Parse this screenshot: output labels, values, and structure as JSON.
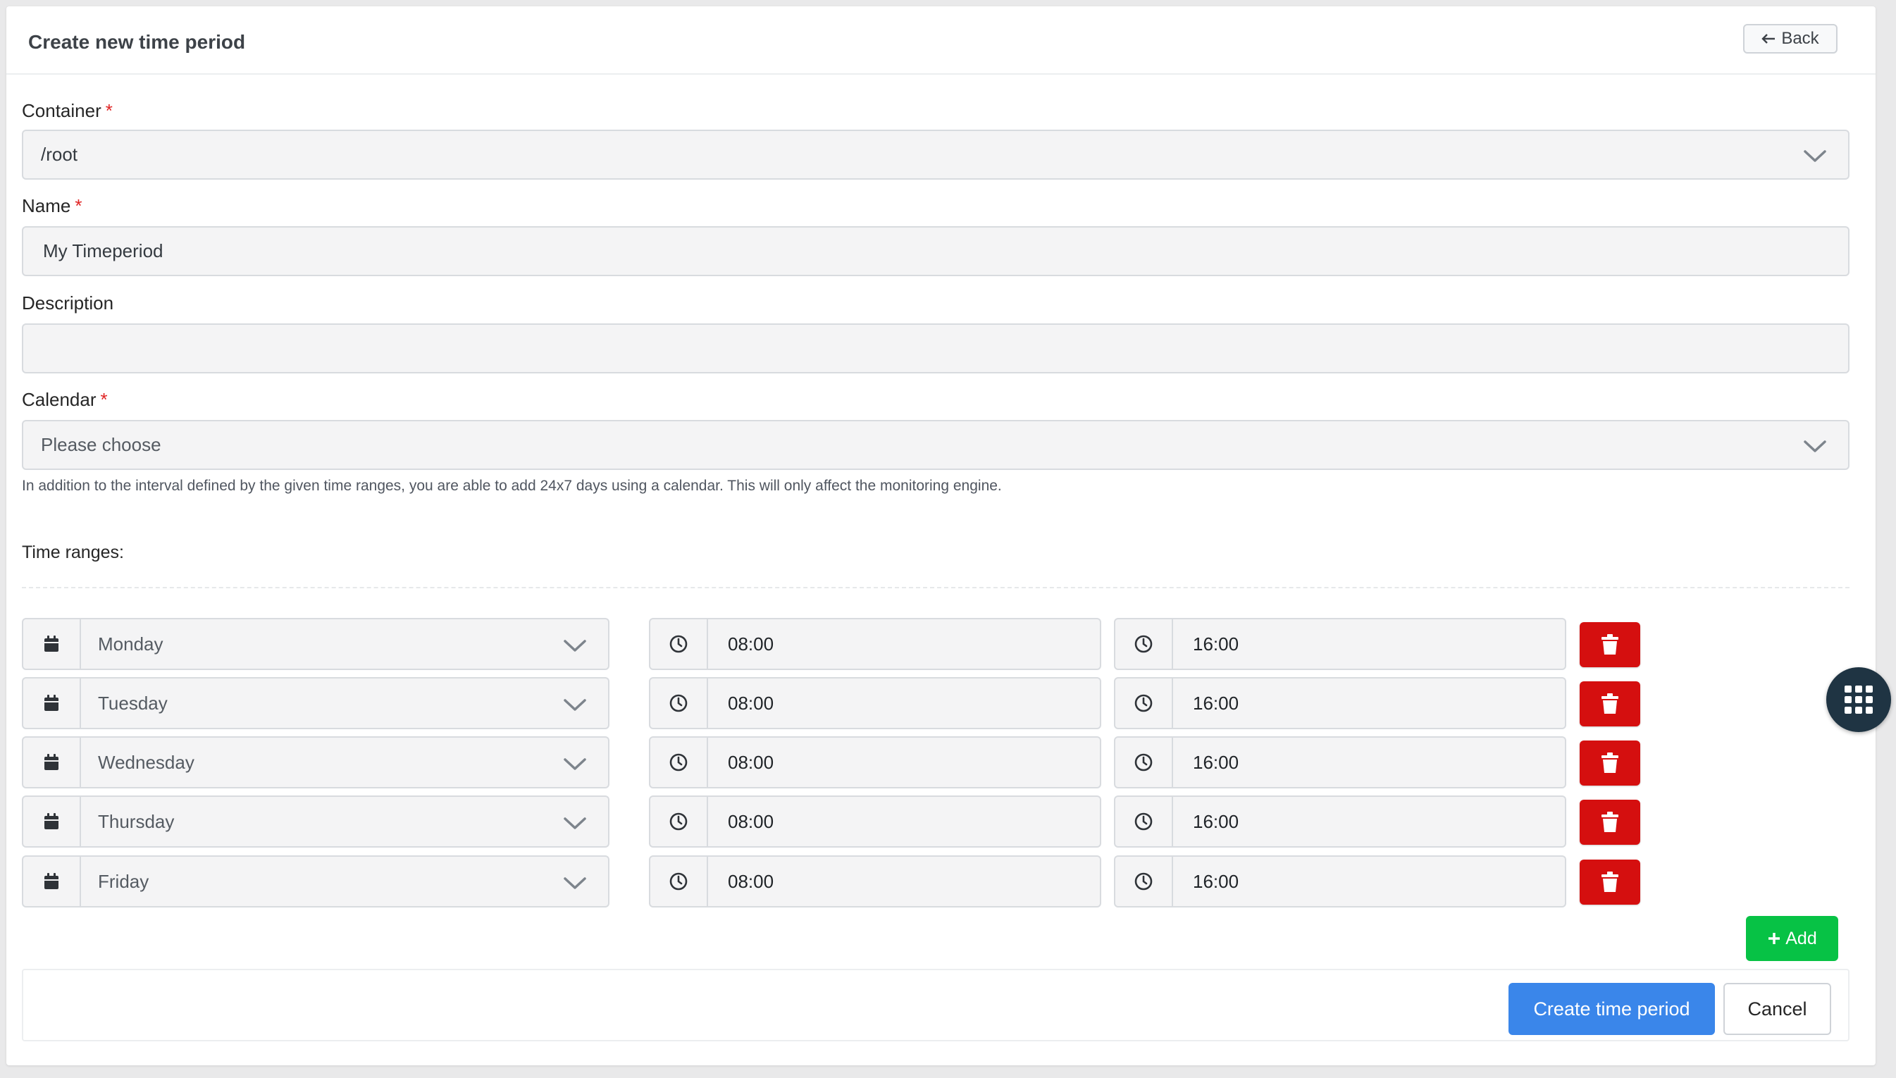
{
  "header": {
    "title": "Create new time period",
    "back_label": "Back"
  },
  "form": {
    "container": {
      "label": "Container",
      "required_mark": "*",
      "value": "/root"
    },
    "name": {
      "label": "Name",
      "required_mark": "*",
      "value": "My Timeperiod"
    },
    "description": {
      "label": "Description",
      "value": ""
    },
    "calendar": {
      "label": "Calendar",
      "required_mark": "*",
      "value": "Please choose",
      "help": "In addition to the interval defined by the given time ranges, you are able to add 24x7 days using a calendar. This will only affect the monitoring engine."
    }
  },
  "time_ranges": {
    "label": "Time ranges:",
    "rows": [
      {
        "day": "Monday",
        "start": "08:00",
        "end": "16:00"
      },
      {
        "day": "Tuesday",
        "start": "08:00",
        "end": "16:00"
      },
      {
        "day": "Wednesday",
        "start": "08:00",
        "end": "16:00"
      },
      {
        "day": "Thursday",
        "start": "08:00",
        "end": "16:00"
      },
      {
        "day": "Friday",
        "start": "08:00",
        "end": "16:00"
      }
    ],
    "add_label": "Add"
  },
  "footer": {
    "submit_label": "Create time period",
    "cancel_label": "Cancel"
  },
  "colors": {
    "primary": "#3a86ea",
    "danger": "#d50f0f",
    "success": "#07c245",
    "fab": "#1f3443"
  },
  "icons": [
    "arrow-left-icon",
    "chevron-down-icon",
    "calendar-icon",
    "clock-icon",
    "trash-icon",
    "plus-icon",
    "grid-menu-icon"
  ]
}
